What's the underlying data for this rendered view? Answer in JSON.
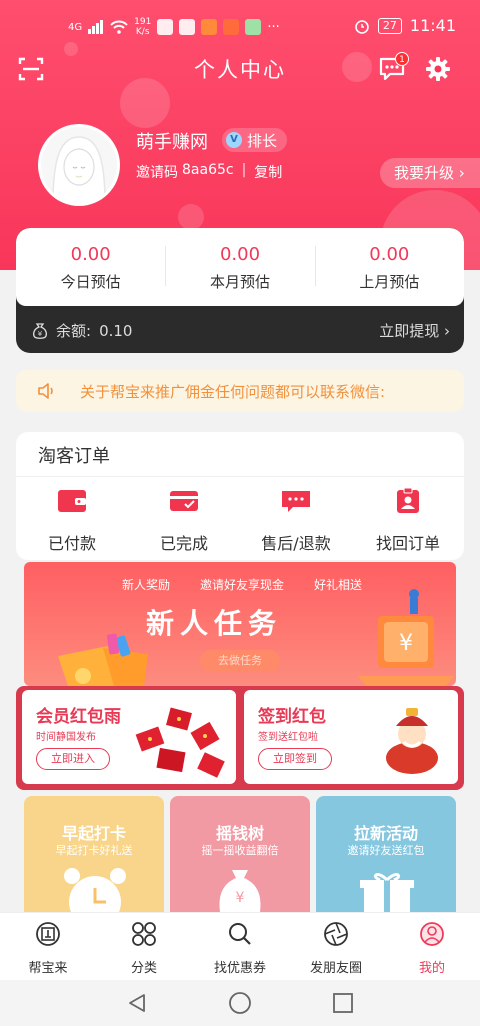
{
  "status_bar": {
    "network": "4G",
    "speed_value": "191",
    "speed_unit": "K/s",
    "battery": "27",
    "time": "11:41"
  },
  "header": {
    "title": "个人中心",
    "message_badge": "1"
  },
  "profile": {
    "username": "萌手赚网",
    "rank_label": "排长",
    "invite_label": "邀请码",
    "invite_code": "8aa65c",
    "copy_label": "复制",
    "upgrade_label": "我要升级 ›"
  },
  "stats": {
    "items": [
      {
        "value": "0.00",
        "label": "今日预估"
      },
      {
        "value": "0.00",
        "label": "本月预估"
      },
      {
        "value": "0.00",
        "label": "上月预估"
      }
    ],
    "balance_label": "余额:",
    "balance_value": "0.10",
    "withdraw_label": "立即提现 ›"
  },
  "notice": {
    "text": "关于帮宝来推广佣金任何问题都可以联系微信:"
  },
  "orders": {
    "title": "淘客订单",
    "items": [
      {
        "label": "已付款",
        "icon": "wallet-icon"
      },
      {
        "label": "已完成",
        "icon": "card-check-icon"
      },
      {
        "label": "售后/退款",
        "icon": "message-card-icon"
      },
      {
        "label": "找回订单",
        "icon": "badge-person-icon"
      }
    ]
  },
  "new_task": {
    "tags": [
      "新人奖励",
      "邀请好友享现金",
      "好礼相送"
    ],
    "title": "新人任务",
    "button": "去做任务"
  },
  "red_packets": [
    {
      "title": "会员红包雨",
      "subtitle": "时间静国发布",
      "button": "立即进入"
    },
    {
      "title": "签到红包",
      "subtitle": "签到送红包啦",
      "button": "立即签到"
    }
  ],
  "tiles": [
    {
      "title": "早起打卡",
      "subtitle": "早起打卡好礼送"
    },
    {
      "title": "摇钱树",
      "subtitle": "摇一摇收益翻倍"
    },
    {
      "title": "拉新活动",
      "subtitle": "邀请好友送红包"
    }
  ],
  "tabbar": {
    "items": [
      {
        "label": "帮宝来"
      },
      {
        "label": "分类"
      },
      {
        "label": "找优惠券"
      },
      {
        "label": "发朋友圈"
      },
      {
        "label": "我的"
      }
    ]
  },
  "colors": {
    "brand": "#f8365a",
    "accent_text": "#f03a5a",
    "notice_text": "#f1913c"
  }
}
